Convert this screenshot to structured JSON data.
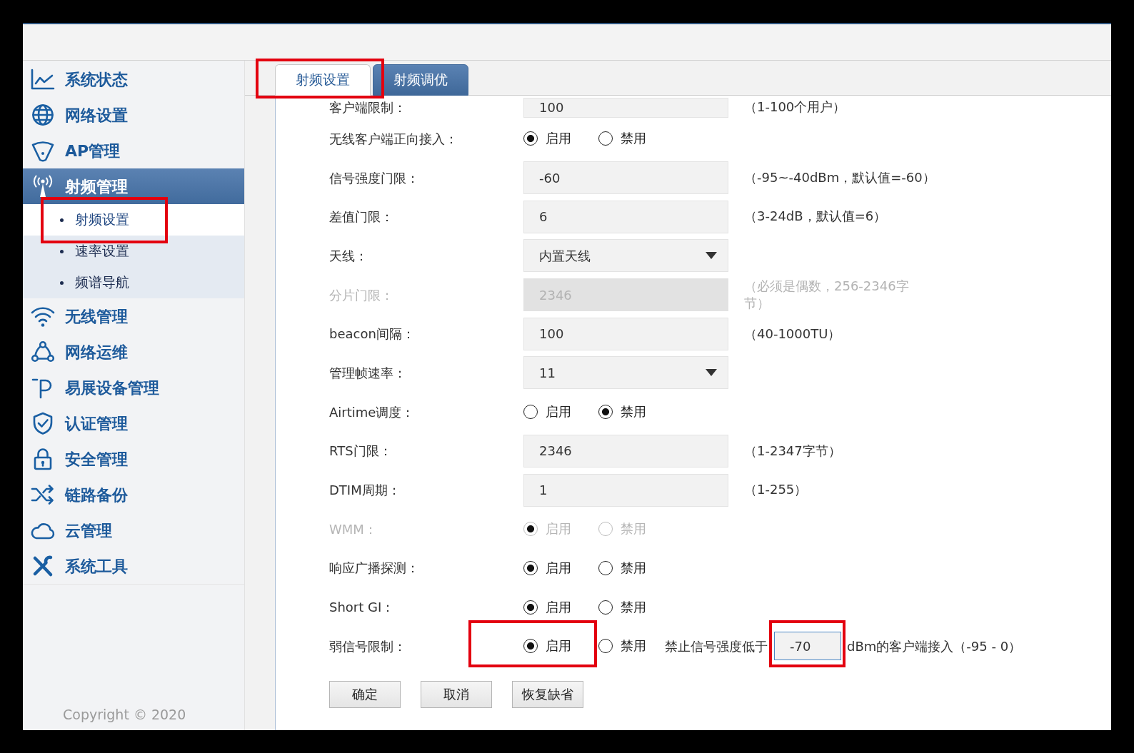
{
  "sidebar": {
    "items": [
      {
        "label": "系统状态",
        "selected": false
      },
      {
        "label": "网络设置",
        "selected": false
      },
      {
        "label": "AP管理",
        "selected": false
      },
      {
        "label": "射频管理",
        "selected": true,
        "children": [
          {
            "label": "射频设置",
            "selected": true,
            "highlighted": true
          },
          {
            "label": "速率设置",
            "selected": false,
            "highlighted": false
          },
          {
            "label": "频谱导航",
            "selected": false,
            "highlighted": false
          }
        ]
      },
      {
        "label": "无线管理",
        "selected": false
      },
      {
        "label": "网络运维",
        "selected": false
      },
      {
        "label": "易展设备管理",
        "selected": false
      },
      {
        "label": "认证管理",
        "selected": false
      },
      {
        "label": "安全管理",
        "selected": false
      },
      {
        "label": "链路备份",
        "selected": false
      },
      {
        "label": "云管理",
        "selected": false
      },
      {
        "label": "系统工具",
        "selected": false
      }
    ],
    "copyright": "Copyright © 2020"
  },
  "tabs": [
    {
      "label": "射频设置",
      "selected": true,
      "highlighted": true
    },
    {
      "label": "射频调优",
      "selected": false,
      "highlighted": false
    }
  ],
  "form": {
    "rows": [
      {
        "kind": "input",
        "label": "客户端限制：",
        "value": "100",
        "hint": "（1-100个用户）",
        "disabled": false
      },
      {
        "kind": "radio",
        "label": "无线客户端正向接入：",
        "disabled": false,
        "options": [
          {
            "label": "启用",
            "selected": true
          },
          {
            "label": "禁用",
            "selected": false
          }
        ]
      },
      {
        "kind": "input",
        "label": "信号强度门限：",
        "value": "-60",
        "hint": "（-95~-40dBm，默认值=-60）",
        "disabled": false
      },
      {
        "kind": "input",
        "label": "差值门限：",
        "value": "6",
        "hint": "（3-24dB，默认值=6）",
        "disabled": false
      },
      {
        "kind": "select",
        "label": "天线：",
        "value": "内置天线",
        "disabled": false
      },
      {
        "kind": "input",
        "label": "分片门限：",
        "value": "2346",
        "hint": "（必须是偶数，256-2346字节）",
        "disabled": true
      },
      {
        "kind": "input",
        "label": "beacon间隔：",
        "value": "100",
        "hint": "（40-1000TU）",
        "disabled": false
      },
      {
        "kind": "select",
        "label": "管理帧速率：",
        "value": "11",
        "disabled": false
      },
      {
        "kind": "radio",
        "label": "Airtime调度：",
        "disabled": false,
        "options": [
          {
            "label": "启用",
            "selected": false
          },
          {
            "label": "禁用",
            "selected": true
          }
        ]
      },
      {
        "kind": "input",
        "label": "RTS门限：",
        "value": "2346",
        "hint": "（1-2347字节）",
        "disabled": false
      },
      {
        "kind": "input",
        "label": "DTIM周期：",
        "value": "1",
        "hint": "（1-255）",
        "disabled": false
      },
      {
        "kind": "radio",
        "label": "WMM：",
        "disabled": true,
        "options": [
          {
            "label": "启用",
            "selected": true
          },
          {
            "label": "禁用",
            "selected": false
          }
        ]
      },
      {
        "kind": "radio",
        "label": "响应广播探测：",
        "disabled": false,
        "options": [
          {
            "label": "启用",
            "selected": true
          },
          {
            "label": "禁用",
            "selected": false
          }
        ]
      },
      {
        "kind": "radio",
        "label": "Short GI：",
        "disabled": false,
        "options": [
          {
            "label": "启用",
            "selected": true
          },
          {
            "label": "禁用",
            "selected": false
          }
        ]
      },
      {
        "kind": "radio_threshold",
        "label": "弱信号限制：",
        "disabled": false,
        "options": [
          {
            "label": "启用",
            "selected": true,
            "highlighted": true
          },
          {
            "label": "禁用",
            "selected": false,
            "highlighted": false
          }
        ],
        "prefix": "禁止信号强度低于",
        "value": "-70",
        "value_focused": true,
        "value_highlighted": true,
        "suffix": "dBm的客户端接入（-95 - 0）"
      }
    ]
  },
  "buttons": [
    {
      "label": "确定"
    },
    {
      "label": "取消"
    },
    {
      "label": "恢复缺省"
    }
  ]
}
